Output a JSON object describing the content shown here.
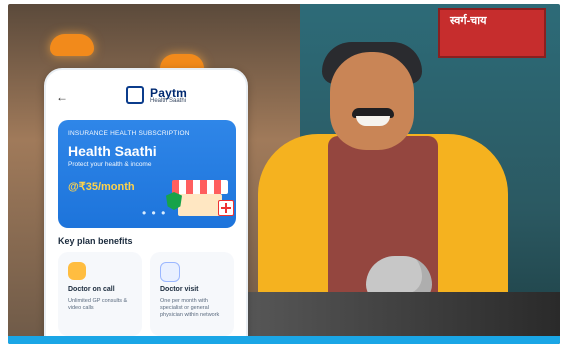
{
  "phone": {
    "header": {
      "back_icon": "←",
      "brand": "Paytm",
      "brand_sub": "Health Saathi"
    },
    "card": {
      "tag": "INSURANCE HEALTH SUBSCRIPTION",
      "title": "Health Saathi",
      "tagline": "Protect your health & income",
      "price": "@₹35/month",
      "dots": "• • •"
    },
    "benefits": {
      "title": "Key plan benefits",
      "items": [
        {
          "label": "Doctor on call",
          "desc": "Unlimited GP consults & video calls"
        },
        {
          "label": "Doctor visit",
          "desc": "One per month with specialist or general physician within network"
        }
      ]
    }
  },
  "scene": {
    "sign_text": "स्वर्ग-चाय"
  },
  "colors": {
    "card_blue": "#1d74db",
    "price_yellow": "#ffd34a",
    "bottom_bar": "#1aa6e6"
  }
}
